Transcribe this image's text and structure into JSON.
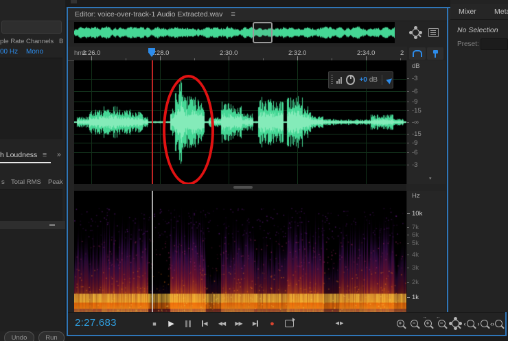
{
  "colors": {
    "accent_blue": "#2d8ceb",
    "panel_border_blue": "#2f76b8",
    "waveform_green": "#45d795",
    "annotation_red": "#e01212",
    "record_red": "#d9442f",
    "time_blue": "#2f9fe0"
  },
  "left_panel": {
    "files": {
      "headers": [
        "ple Rate",
        "Channels",
        "B"
      ],
      "row": {
        "sample_rate": "00 Hz",
        "channels": "Mono"
      }
    },
    "loudness": {
      "tab_label": "h Loudness",
      "menu_icon": "≡",
      "expand_chevrons": "»",
      "headers": [
        "s",
        "Total RMS",
        "Peak"
      ]
    },
    "undo_button": "Undo",
    "run_button": "Run"
  },
  "editor": {
    "title": "Editor: voice-over-track-1 Audio Extracted.wav",
    "menu_icon": "≡",
    "ruler": {
      "unit": "hms",
      "tick_labels": [
        "2:26.0",
        "2:28.0",
        "2:30.0",
        "2:32.0",
        "2:34.0",
        "2"
      ]
    },
    "db_scale": {
      "title": "dB",
      "labels": [
        "-3",
        "-6",
        "-9",
        "-15",
        "-∞",
        "-15",
        "-9",
        "-6",
        "-3"
      ],
      "scroll_arrow": "▾"
    },
    "hud": {
      "gain_value": "+0",
      "gain_unit": "dB"
    },
    "freq_scale": {
      "title": "Hz",
      "labels": [
        "10k",
        "7k",
        "6k",
        "5k",
        "4k",
        "3k",
        "2k",
        "1k"
      ]
    },
    "transport": {
      "time_display": "2:27.683",
      "icons": {
        "stop": "■",
        "play": "▶",
        "prev": "◀",
        "rewind": "◀◀",
        "fast_forward": "▶▶",
        "next": "▶",
        "record": "●",
        "skip": "◀▶"
      },
      "zoom_glyphs": {
        "plus": "+",
        "minus": "−",
        "arrow_right": "→",
        "arrow_left": "←",
        "in_point": "‹",
        "out_point": "›",
        "selection": "‹›"
      }
    }
  },
  "right_panel": {
    "tabs": [
      "Mixer",
      "Meta"
    ],
    "selection_status": "No Selection",
    "preset_label": "Preset:"
  }
}
